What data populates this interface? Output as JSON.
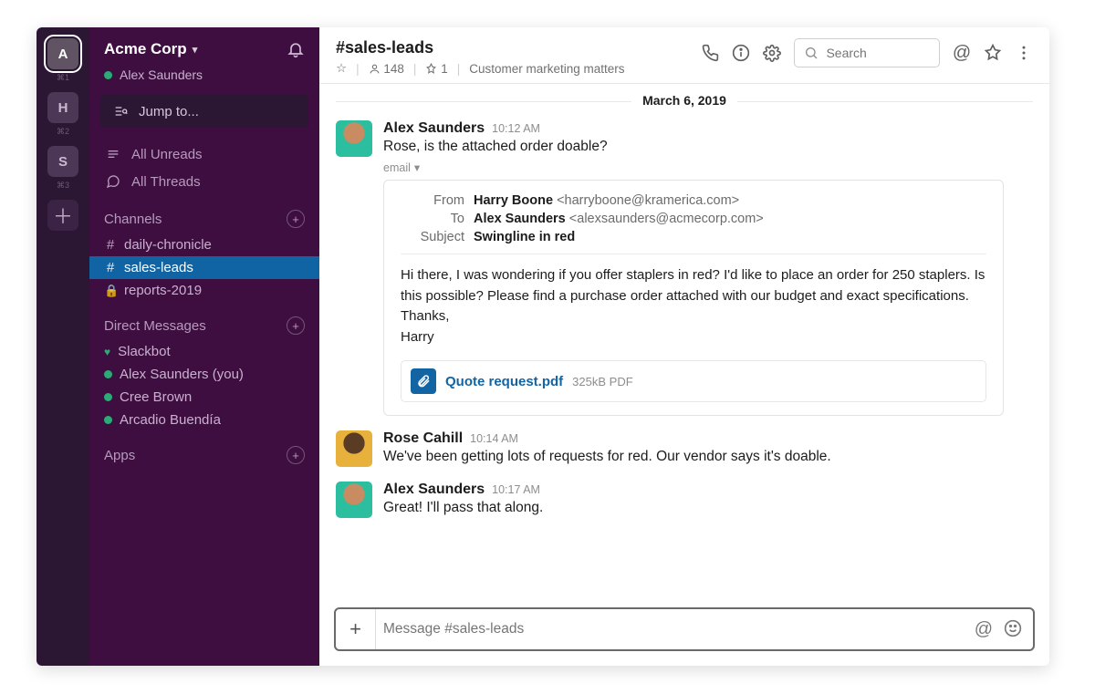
{
  "workspaces": [
    {
      "letter": "A",
      "key": "⌘1",
      "active": true
    },
    {
      "letter": "H",
      "key": "⌘2",
      "active": false
    },
    {
      "letter": "S",
      "key": "⌘3",
      "active": false
    }
  ],
  "team": {
    "name": "Acme Corp",
    "user": "Alex Saunders"
  },
  "jump": "Jump to...",
  "nav": {
    "unreads": "All Unreads",
    "threads": "All Threads"
  },
  "sections": {
    "channels": "Channels",
    "dms": "Direct Messages",
    "apps": "Apps"
  },
  "channels": [
    {
      "name": "daily-chronicle",
      "private": false,
      "active": false
    },
    {
      "name": "sales-leads",
      "private": false,
      "active": true
    },
    {
      "name": "reports-2019",
      "private": true,
      "active": false
    }
  ],
  "dms": [
    {
      "name": "Slackbot",
      "heart": true
    },
    {
      "name": "Alex Saunders (you)"
    },
    {
      "name": "Cree Brown"
    },
    {
      "name": "Arcadio Buendía"
    }
  ],
  "header": {
    "channel": "#sales-leads",
    "members": "148",
    "pins": "1",
    "topic": "Customer marketing matters",
    "search_placeholder": "Search"
  },
  "date_divider": "March 6, 2019",
  "messages": [
    {
      "author": "Alex Saunders",
      "time": "10:12 AM",
      "text": "Rose, is the attached order doable?",
      "avatar": "#2bbfa0",
      "email_tag": "email",
      "email": {
        "from_name": "Harry Boone",
        "from_email": "<harryboone@kramerica.com>",
        "to_name": "Alex Saunders",
        "to_email": "<alexsaunders@acmecorp.com>",
        "subject": "Swingline in red",
        "body_l1": "Hi there, I was wondering if you offer staplers in red? I'd like to place an order for 250 staplers. Is this possible? Please find a purchase order attached with our budget and exact specifications.",
        "body_l2": "Thanks,",
        "body_l3": "Harry",
        "attachment": {
          "name": "Quote request.pdf",
          "meta": "325kB PDF"
        },
        "labels": {
          "from": "From",
          "to": "To",
          "subject": "Subject"
        }
      }
    },
    {
      "author": "Rose Cahill",
      "time": "10:14 AM",
      "text": "We've been getting lots of requests for red. Our vendor says it's doable.",
      "avatar": "#e7b13c"
    },
    {
      "author": "Alex Saunders",
      "time": "10:17 AM",
      "text": "Great! I'll pass that along.",
      "avatar": "#2bbfa0"
    }
  ],
  "composer": {
    "placeholder": "Message #sales-leads"
  }
}
